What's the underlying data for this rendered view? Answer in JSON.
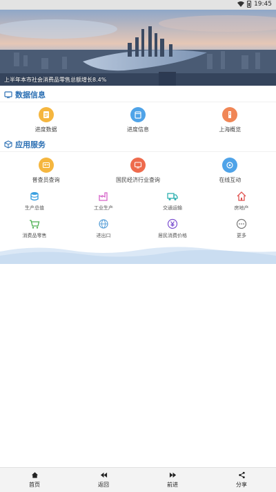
{
  "status_bar": {
    "time": "19:45"
  },
  "banner": {
    "caption": "上半年本市社会消费品零售总额增长8.4%"
  },
  "data_section": {
    "title": "数据信息",
    "items": [
      {
        "label": "进度数据",
        "icon": "document-icon",
        "color": "#f5b63f"
      },
      {
        "label": "进度信息",
        "icon": "calendar-icon",
        "color": "#4fa3e8"
      },
      {
        "label": "上海概览",
        "icon": "building-icon",
        "color": "#f08656"
      }
    ]
  },
  "service_section": {
    "title": "应用服务",
    "primary_items": [
      {
        "label": "普查员查询",
        "icon": "id-card-icon",
        "color": "#f5b63f"
      },
      {
        "label": "国民经济行业查询",
        "icon": "monitor-icon",
        "color": "#ee6b4d"
      },
      {
        "label": "在线互动",
        "icon": "chat-icon",
        "color": "#4fa3e8"
      }
    ],
    "row1": [
      {
        "label": "生产总值",
        "icon": "database-icon",
        "color": "#3aa0e0"
      },
      {
        "label": "工业生产",
        "icon": "factory-icon",
        "color": "#d660c8"
      },
      {
        "label": "交通运输",
        "icon": "truck-icon",
        "color": "#2fb1b1"
      },
      {
        "label": "房地产",
        "icon": "house-icon",
        "color": "#e0524f"
      }
    ],
    "row2": [
      {
        "label": "消费品零售",
        "icon": "cart-icon",
        "color": "#4caf50"
      },
      {
        "label": "进出口",
        "icon": "globe-icon",
        "color": "#5aa0d8"
      },
      {
        "label": "居民消费价格",
        "icon": "yuan-icon",
        "color": "#7b4fd0"
      },
      {
        "label": "更多",
        "icon": "more-icon",
        "color": "#777777"
      }
    ]
  },
  "tab_bar": {
    "items": [
      {
        "label": "首页",
        "icon": "home-icon"
      },
      {
        "label": "返回",
        "icon": "rewind-icon"
      },
      {
        "label": "前进",
        "icon": "forward-icon"
      },
      {
        "label": "分享",
        "icon": "share-icon"
      }
    ]
  }
}
